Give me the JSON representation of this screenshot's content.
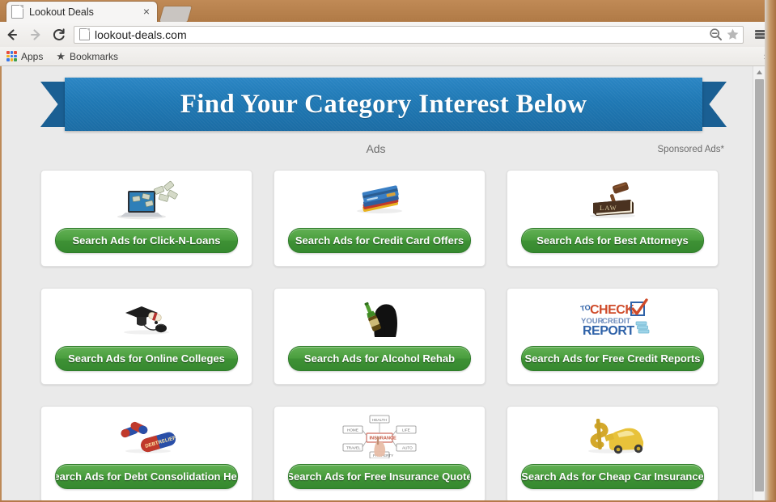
{
  "browser": {
    "tab": {
      "title": "Lookout Deals",
      "close_label": "×",
      "favicon": "page-icon"
    },
    "newtab_label": "",
    "nav": {
      "back": "←",
      "forward": "→",
      "reload": "↻"
    },
    "url": "lookout-deals.com",
    "url_icons": {
      "zoom": "zoom-out-icon",
      "bookmark": "star-icon"
    },
    "menu": "hamburger-menu-icon",
    "bookmarks_bar": {
      "apps_label": "Apps",
      "bookmarks_label": "Bookmarks",
      "overflow_label": "»"
    }
  },
  "page": {
    "banner_text": "Find Your Category Interest Below",
    "ads_label": "Ads",
    "sponsored_label": "Sponsored Ads*",
    "cards": [
      {
        "icon": "laptop-money-icon",
        "button_label": "Search Ads for Click-N-Loans"
      },
      {
        "icon": "credit-cards-icon",
        "button_label": "Search Ads for Credit Card Offers"
      },
      {
        "icon": "law-book-gavel-icon",
        "button_label": "Search Ads for Best Attorneys"
      },
      {
        "icon": "graduation-cap-mouse-icon",
        "button_label": "Search Ads for Online Colleges"
      },
      {
        "icon": "person-bottle-icon",
        "button_label": "Search Ads for Alcohol Rehab"
      },
      {
        "icon": "check-credit-report-icon",
        "button_label": "Search Ads for Free Credit Reports"
      },
      {
        "icon": "debt-relief-pills-icon",
        "button_label": "Search Ads for Debt Consolidation Help"
      },
      {
        "icon": "insurance-diagram-icon",
        "button_label": "Search Ads for Free Insurance Quote"
      },
      {
        "icon": "dollar-car-icon",
        "button_label": "Search Ads for Cheap Car Insurance"
      }
    ]
  },
  "colors": {
    "banner_blue": "#1f78b4",
    "button_green": "#4a9e3e",
    "page_bg": "#eaeaea",
    "chrome_frame": "#b5794a"
  }
}
